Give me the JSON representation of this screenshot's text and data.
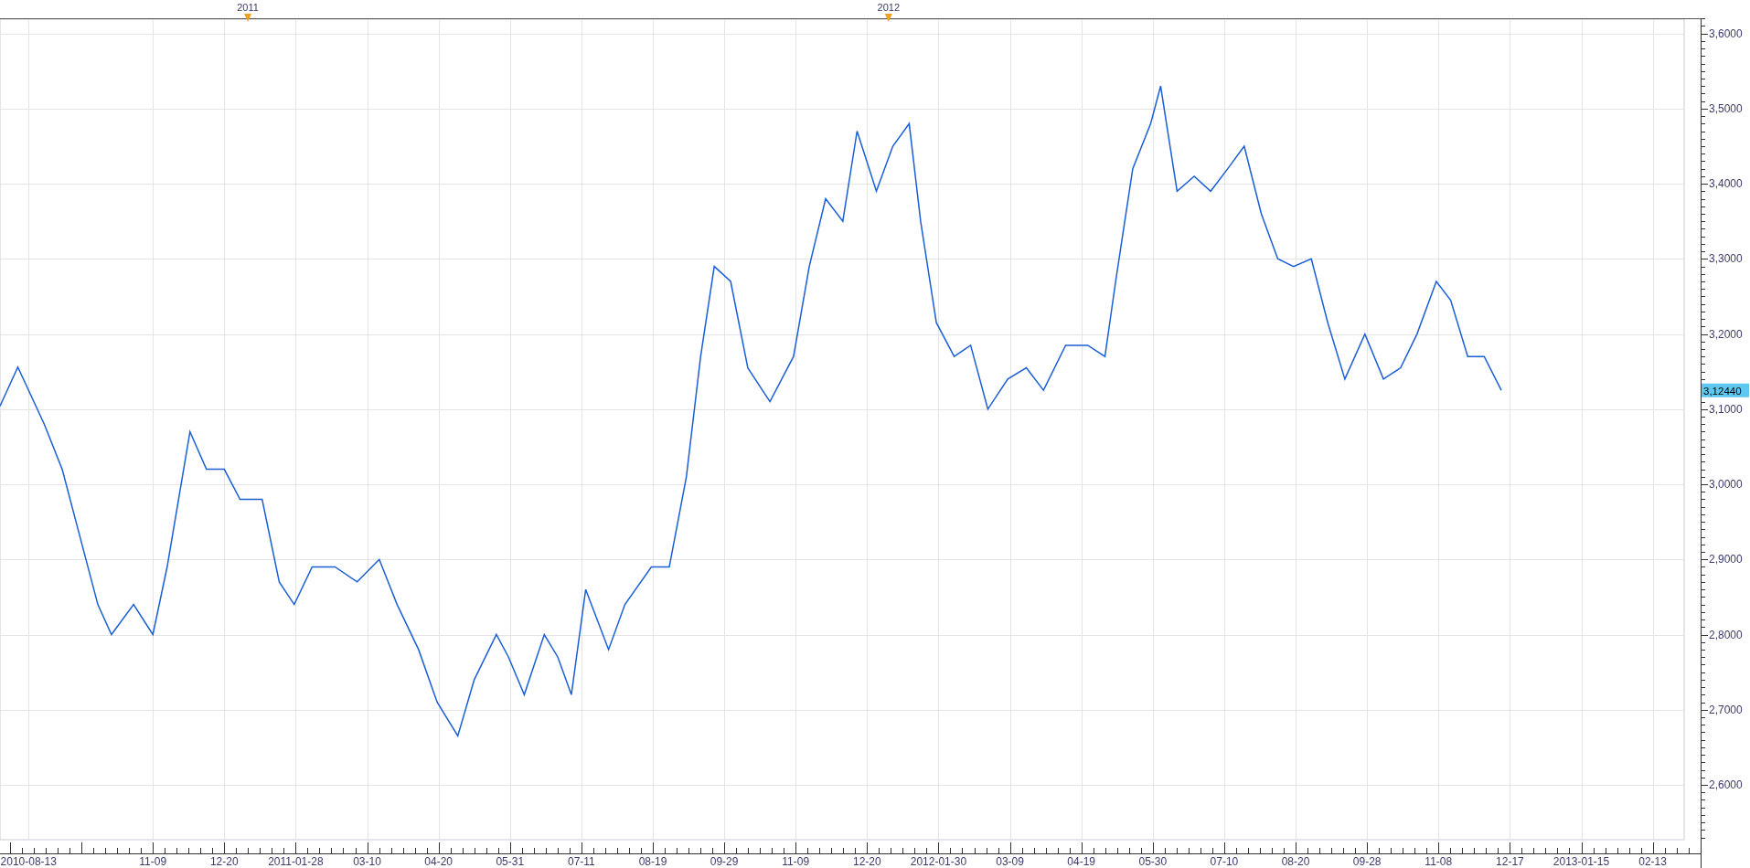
{
  "chart": {
    "year_markers": [
      "2011",
      "2012"
    ],
    "price_tag": "3,12440",
    "y_axis_labels": [
      "3,6000",
      "3,5000",
      "3,4000",
      "3,3000",
      "3,2000",
      "3,1000",
      "3,0000",
      "2,9000",
      "2,8000",
      "2,7000",
      "2,6000"
    ],
    "x_axis_labels": [
      "2010-08-13",
      "11-09",
      "12-20",
      "2011-01-28",
      "03-10",
      "04-20",
      "05-31",
      "07-11",
      "08-19",
      "09-29",
      "11-09",
      "12-20",
      "2012-01-30",
      "03-09",
      "04-19",
      "05-30",
      "07-10",
      "08-20",
      "09-28",
      "11-08",
      "12-17",
      "2013-01-15",
      "02-13"
    ]
  }
}
